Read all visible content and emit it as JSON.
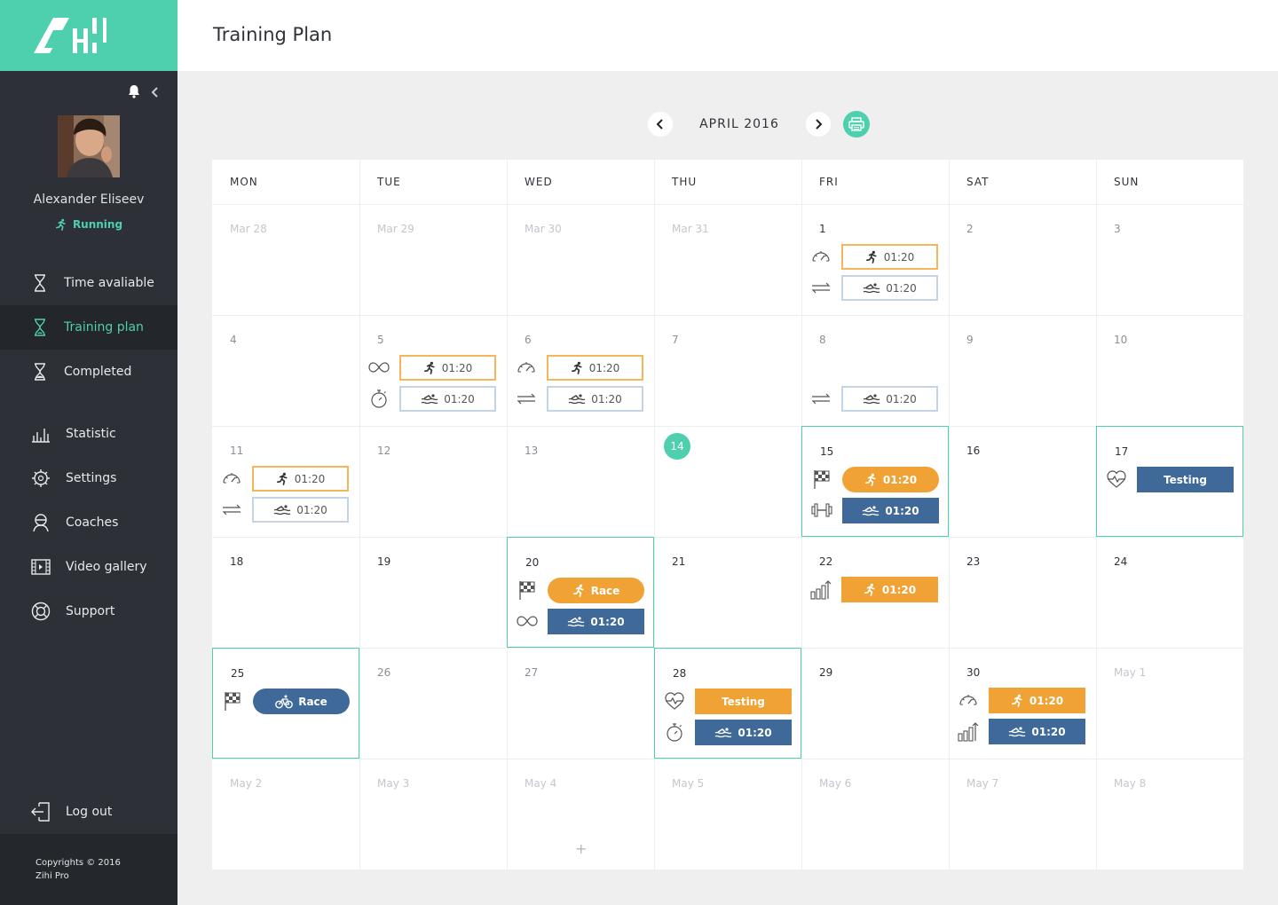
{
  "app": {
    "title": "Training Plan",
    "colors": {
      "accent": "#4ecfae",
      "orange": "#f0a234",
      "blue": "#3e6998",
      "sidebar": "#2d3037"
    }
  },
  "user": {
    "name": "Alexander Eliseev",
    "sport": "Running"
  },
  "nav": {
    "items": [
      {
        "label": "Time avaliable",
        "icon": "hourglass-icon",
        "active": false
      },
      {
        "label": "Training plan",
        "icon": "hourglass-icon",
        "active": true
      },
      {
        "label": "Completed",
        "icon": "hourglass-icon",
        "active": false
      },
      {
        "label": "Statistic",
        "icon": "bar-chart-icon",
        "active": false
      },
      {
        "label": "Settings",
        "icon": "gear-icon",
        "active": false
      },
      {
        "label": "Coaches",
        "icon": "coach-icon",
        "active": false
      },
      {
        "label": "Video gallery",
        "icon": "film-icon",
        "active": false
      },
      {
        "label": "Support",
        "icon": "lifebuoy-icon",
        "active": false
      }
    ],
    "logout": "Log out"
  },
  "footer": {
    "line1": "Copyrights © 2016",
    "line2": "Zihi Pro"
  },
  "calendar": {
    "month_label": "APRIL 2016",
    "weekdays": [
      "MON",
      "TUE",
      "WED",
      "THU",
      "FRI",
      "SAT",
      "SUN"
    ],
    "weeks": [
      [
        {
          "day": "Mar 28",
          "style": "faded"
        },
        {
          "day": "Mar 29",
          "style": "faded"
        },
        {
          "day": "Mar 30",
          "style": "faded"
        },
        {
          "day": "Mar 31",
          "style": "faded"
        },
        {
          "day": "1",
          "style": "normal",
          "events": [
            {
              "icon": "speedometer-icon",
              "kind": "o-out",
              "sport": "run",
              "text": "01:20"
            },
            {
              "icon": "exchange-icon",
              "kind": "b-out",
              "sport": "swim",
              "text": "01:20"
            }
          ]
        },
        {
          "day": "2",
          "style": "light"
        },
        {
          "day": "3",
          "style": "light"
        }
      ],
      [
        {
          "day": "4",
          "style": "light"
        },
        {
          "day": "5",
          "style": "light",
          "events": [
            {
              "icon": "infinity-icon",
              "kind": "o-out",
              "sport": "run",
              "text": "01:20"
            },
            {
              "icon": "stopwatch-icon",
              "kind": "b-out",
              "sport": "swim",
              "text": "01:20"
            }
          ]
        },
        {
          "day": "6",
          "style": "light",
          "events": [
            {
              "icon": "speedometer-icon",
              "kind": "o-out",
              "sport": "run",
              "text": "01:20"
            },
            {
              "icon": "exchange-icon",
              "kind": "b-out",
              "sport": "swim",
              "text": "01:20"
            }
          ]
        },
        {
          "day": "7",
          "style": "light"
        },
        {
          "day": "8",
          "style": "light",
          "events": [
            null,
            {
              "icon": "exchange-icon",
              "kind": "b-out",
              "sport": "swim",
              "text": "01:20"
            }
          ]
        },
        {
          "day": "9",
          "style": "light"
        },
        {
          "day": "10",
          "style": "light"
        }
      ],
      [
        {
          "day": "11",
          "style": "light",
          "events": [
            {
              "icon": "speedometer-icon",
              "kind": "o-out",
              "sport": "run",
              "text": "01:20"
            },
            {
              "icon": "exchange-icon",
              "kind": "b-out",
              "sport": "swim",
              "text": "01:20"
            }
          ]
        },
        {
          "day": "12",
          "style": "light"
        },
        {
          "day": "13",
          "style": "light"
        },
        {
          "day": "14",
          "style": "today"
        },
        {
          "day": "15",
          "style": "normal",
          "selected": true,
          "events": [
            {
              "icon": "flag-icon",
              "kind": "o-fill pill",
              "sport": "run",
              "text": "01:20"
            },
            {
              "icon": "dumbbell-icon",
              "kind": "b-fill",
              "sport": "swim",
              "text": "01:20"
            }
          ]
        },
        {
          "day": "16",
          "style": "normal"
        },
        {
          "day": "17",
          "style": "normal",
          "selected": true,
          "events": [
            {
              "icon": "heart-pulse-icon",
              "kind": "b-fill",
              "sport": "",
              "text": "Testing"
            }
          ]
        }
      ],
      [
        {
          "day": "18",
          "style": "normal"
        },
        {
          "day": "19",
          "style": "normal"
        },
        {
          "day": "20",
          "style": "normal",
          "selected": true,
          "events": [
            {
              "icon": "flag-icon",
              "kind": "o-fill pill",
              "sport": "run",
              "text": "Race"
            },
            {
              "icon": "infinity-icon",
              "kind": "b-fill",
              "sport": "swim",
              "text": "01:20"
            }
          ]
        },
        {
          "day": "21",
          "style": "normal"
        },
        {
          "day": "22",
          "style": "normal",
          "events": [
            {
              "icon": "progress-icon",
              "kind": "o-fill",
              "sport": "run",
              "text": "01:20"
            }
          ]
        },
        {
          "day": "23",
          "style": "normal"
        },
        {
          "day": "24",
          "style": "normal"
        }
      ],
      [
        {
          "day": "25",
          "style": "normal",
          "selected": true,
          "events": [
            {
              "icon": "flag-icon",
              "kind": "b-fill pill",
              "sport": "bike",
              "text": "Race"
            }
          ]
        },
        {
          "day": "26",
          "style": "light"
        },
        {
          "day": "27",
          "style": "light"
        },
        {
          "day": "28",
          "style": "normal",
          "selected": true,
          "events": [
            {
              "icon": "heart-pulse-icon",
              "kind": "o-fill",
              "sport": "",
              "text": "Testing"
            },
            {
              "icon": "stopwatch-icon",
              "kind": "b-fill",
              "sport": "swim",
              "text": "01:20"
            }
          ]
        },
        {
          "day": "29",
          "style": "normal"
        },
        {
          "day": "30",
          "style": "normal",
          "events": [
            {
              "icon": "speedometer-icon",
              "kind": "o-fill",
              "sport": "run",
              "text": "01:20"
            },
            {
              "icon": "progress-icon",
              "kind": "b-fill",
              "sport": "swim",
              "text": "01:20"
            }
          ]
        },
        {
          "day": "May 1",
          "style": "faded"
        }
      ],
      [
        {
          "day": "May 2",
          "style": "faded"
        },
        {
          "day": "May 3",
          "style": "faded"
        },
        {
          "day": "May 4",
          "style": "faded",
          "plus": "+"
        },
        {
          "day": "May 5",
          "style": "faded"
        },
        {
          "day": "May 6",
          "style": "faded"
        },
        {
          "day": "May 7",
          "style": "faded"
        },
        {
          "day": "May 8",
          "style": "faded"
        }
      ]
    ]
  }
}
